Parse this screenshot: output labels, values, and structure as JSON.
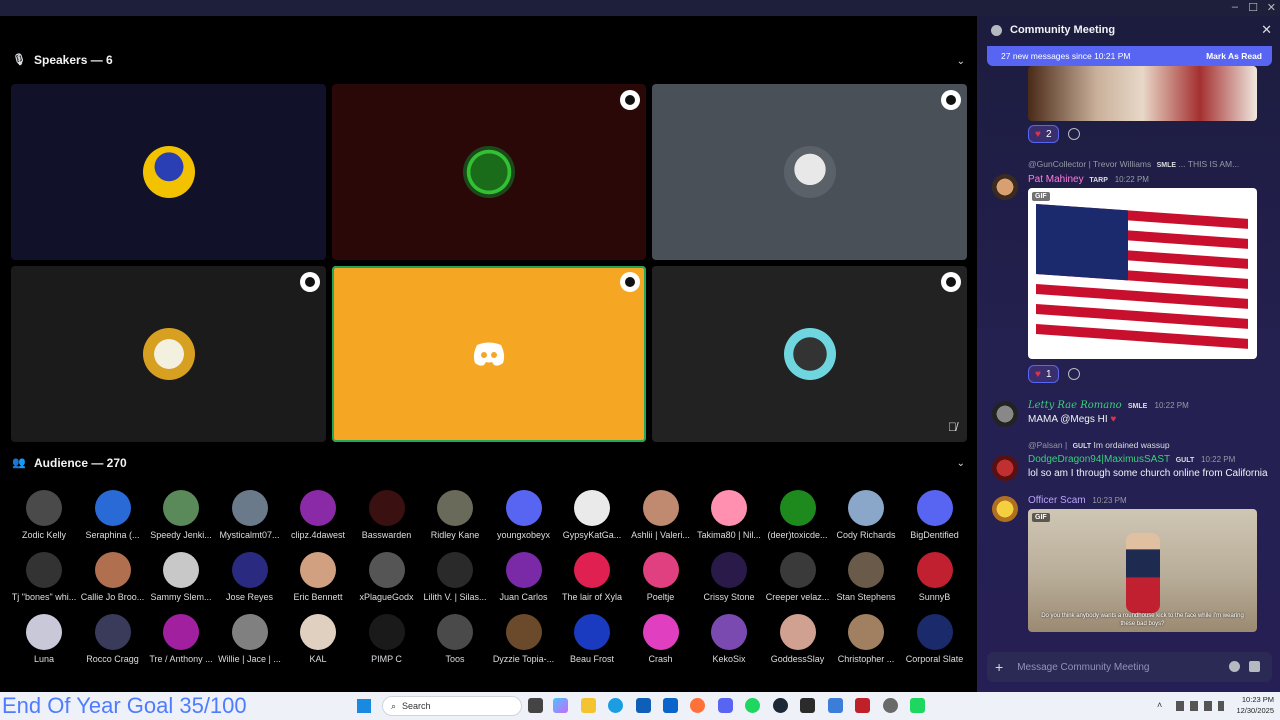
{
  "window": {
    "minimize": "–",
    "maximize": "☐",
    "close": "✕"
  },
  "speakers": {
    "header": "Speakers — 6",
    "icon": "microphone-icon"
  },
  "audience": {
    "header": "Audience — 270",
    "icon": "people-icon",
    "members": [
      "Zodic Kelly",
      "Seraphina (...",
      "Speedy Jenki...",
      "Mysticalmt07...",
      "clipz.4dawest",
      "Basswarden",
      "Ridley Kane",
      "youngxobeyx",
      "GypsyKatGa...",
      "Ashlii | Valeri...",
      "Takima80 | Nil...",
      "(deer)toxicde...",
      "Cody Richards",
      "BigDentified",
      "Tj \"bones\" whi...",
      "Callie Jo Broo...",
      "Sammy Slem...",
      "Jose Reyes",
      "Eric Bennett",
      "xPlagueGodx",
      "Lilith V. | Silas...",
      "Juan Carlos",
      "The lair of Xyla",
      "Poeltje",
      "Crissy Stone",
      "Creeper velaz...",
      "Stan Stephens",
      "SunnyB",
      "Luna",
      "Rocco Cragg",
      "Tre / Anthony ...",
      "Willie | Jace | ...",
      "KAL",
      "PIMP C",
      "Toos",
      "Dyzzie Topia-...",
      "Beau Frost",
      "Crash",
      "KekoSix",
      "GoddessSlay",
      "Christopher ...",
      "Corporal Slate"
    ]
  },
  "chat": {
    "title": "Community Meeting",
    "new_messages": "27 new messages since 10:21 PM",
    "mark_as_read": "Mark As Read",
    "messages": [
      {
        "reaction_count": "2"
      },
      {
        "reply_to": "@GunCollector | Trevor Williams",
        "reply_tag": "SMLE",
        "reply_text": "... THIS IS AM...",
        "author": "Pat Mahiney",
        "tag": "TARP",
        "time": "10:22 PM",
        "gif_label": "GIF",
        "reaction_count": "1"
      },
      {
        "author": "Letty Rae Romano",
        "tag": "SMLE",
        "time": "10:22 PM",
        "text": "MAMA @Megs  HI"
      },
      {
        "reply_to": "@Palsan |",
        "reply_tag": "GULT",
        "reply_text": "Im ordained wassup",
        "author": "DodgeDragon94|MaximusSAST",
        "tag": "GULT",
        "time": "10:22 PM",
        "text": "lol so am I through some church online from California"
      },
      {
        "author": "Officer Scam",
        "time": "10:23 PM",
        "gif_label": "GIF",
        "caption": "Do you think anybody wants a roundhouse kick to the face while I'm wearing these bad boys?"
      }
    ],
    "composer_placeholder": "Message Community Meeting"
  },
  "taskbar": {
    "goal": "End Of Year Goal 35/100",
    "search": "Search",
    "time": "10:23 PM",
    "date": "12/30/2025"
  },
  "colors": {
    "accent": "#5865f2",
    "speaking": "#23a55a",
    "tile_orange": "#f5a623",
    "goal_text": "#4f7cff"
  }
}
